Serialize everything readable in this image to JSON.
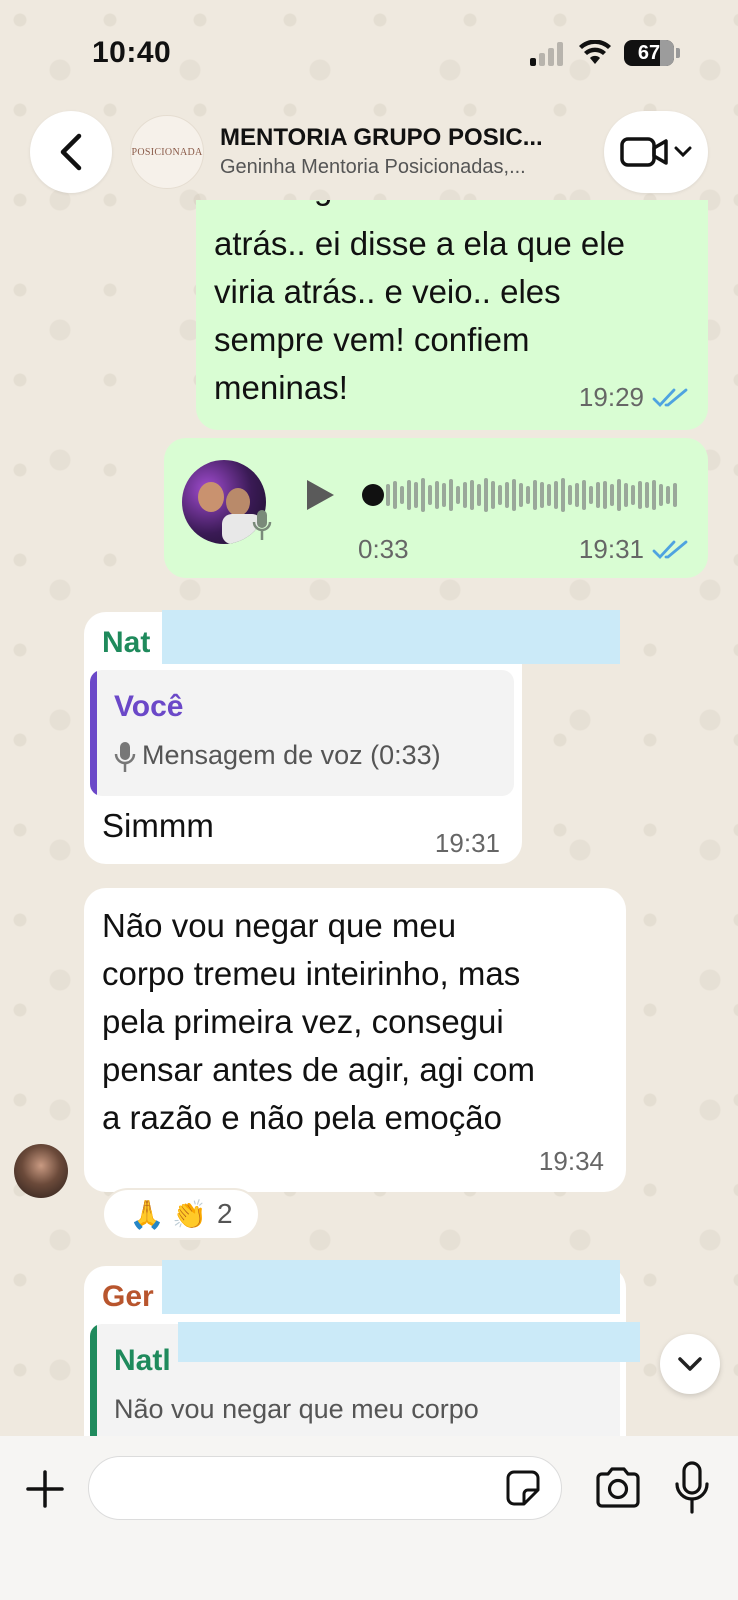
{
  "status_bar": {
    "time": "10:40",
    "battery": "67"
  },
  "header": {
    "title": "MENTORIA GRUPO POSIC...",
    "subtitle": "Geninha Mentoria Posicionadas,...",
    "avatar_text": "POSICIONADA"
  },
  "messages": {
    "out_text": {
      "text_partial_top": "g",
      "lines": [
        "atrás.. ei disse a ela que ele",
        "viria atrás.. e veio.. eles",
        "sempre vem! confiem",
        "meninas!"
      ],
      "time": "19:29"
    },
    "out_voice": {
      "duration": "0:33",
      "time": "19:31"
    },
    "in_reply": {
      "sender": "Nat",
      "quote_sender": "Você",
      "quote_text": "Mensagem de voz (0:33)",
      "text": "Simmm",
      "time": "19:31"
    },
    "in_long": {
      "lines": [
        "Não vou negar que meu",
        "corpo tremeu inteirinho, mas",
        "pela primeira vez, consegui",
        "pensar antes de agir, agi com",
        "a razão e não pela emoção"
      ],
      "time": "19:34",
      "reactions": {
        "emojis": "🙏 👏",
        "count": "2"
      }
    },
    "in_partial": {
      "sender": "Ger",
      "quote_sender": "Natl",
      "quote_text": "Não vou negar que meu corpo"
    }
  },
  "colors": {
    "outgoing_bubble": "#d9fdd3",
    "incoming_bubble": "#ffffff",
    "read_ticks": "#4fa3e0",
    "sender_nat": "#1f8a5c",
    "sender_ger": "#b8552d",
    "quote_voce": "#6b48c8"
  },
  "icons": [
    "back-chevron-icon",
    "video-camera-icon",
    "chevron-down-icon",
    "play-icon",
    "microphone-icon",
    "double-check-icon",
    "plus-icon",
    "sticker-icon",
    "camera-icon",
    "mic-icon"
  ]
}
